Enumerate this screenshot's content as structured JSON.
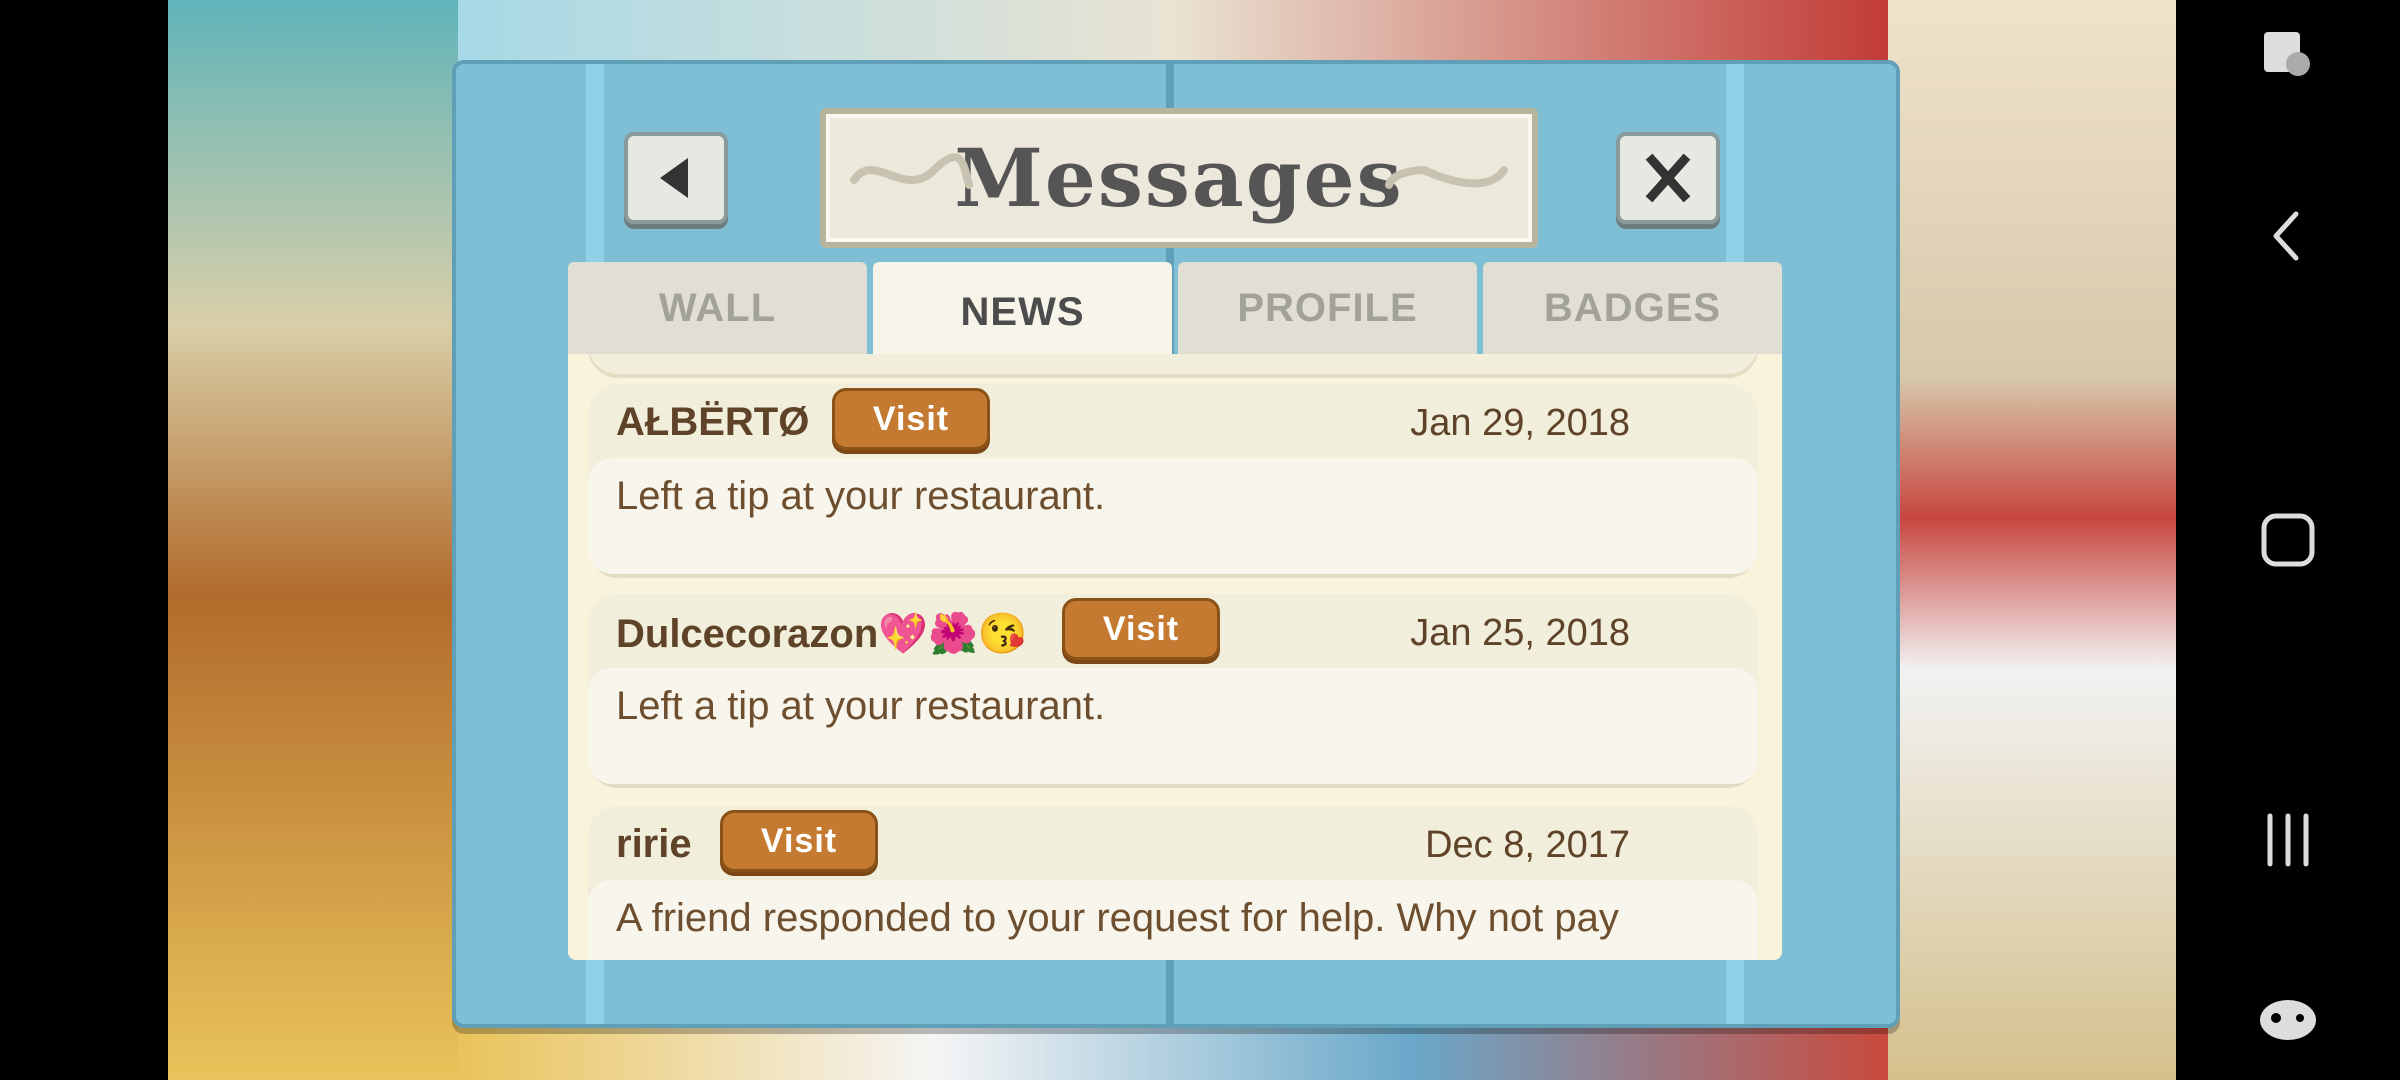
{
  "dialog": {
    "title": "Messages",
    "tabs": [
      {
        "label": "WALL",
        "active": false
      },
      {
        "label": "NEWS",
        "active": true
      },
      {
        "label": "PROFILE",
        "active": false
      },
      {
        "label": "BADGES",
        "active": false
      }
    ],
    "visit_label": "Visit",
    "messages": [
      {
        "name": "AŁBËRTØ",
        "date": "Jan 29, 2018",
        "text": "Left a tip at your restaurant."
      },
      {
        "name": "Dulcecorazon💖🌺😘",
        "date": "Jan 25, 2018",
        "text": "Left a tip at your restaurant."
      },
      {
        "name": "ririe",
        "date": "Dec 8, 2017",
        "text": "A friend responded to your request for help. Why not pay"
      }
    ]
  },
  "icons": {
    "back": "back-arrow-icon",
    "close": "close-x-icon"
  },
  "colors": {
    "panel": "#7fbfd6",
    "visit_button": "#c57a31",
    "text_brown": "#5e4328"
  }
}
